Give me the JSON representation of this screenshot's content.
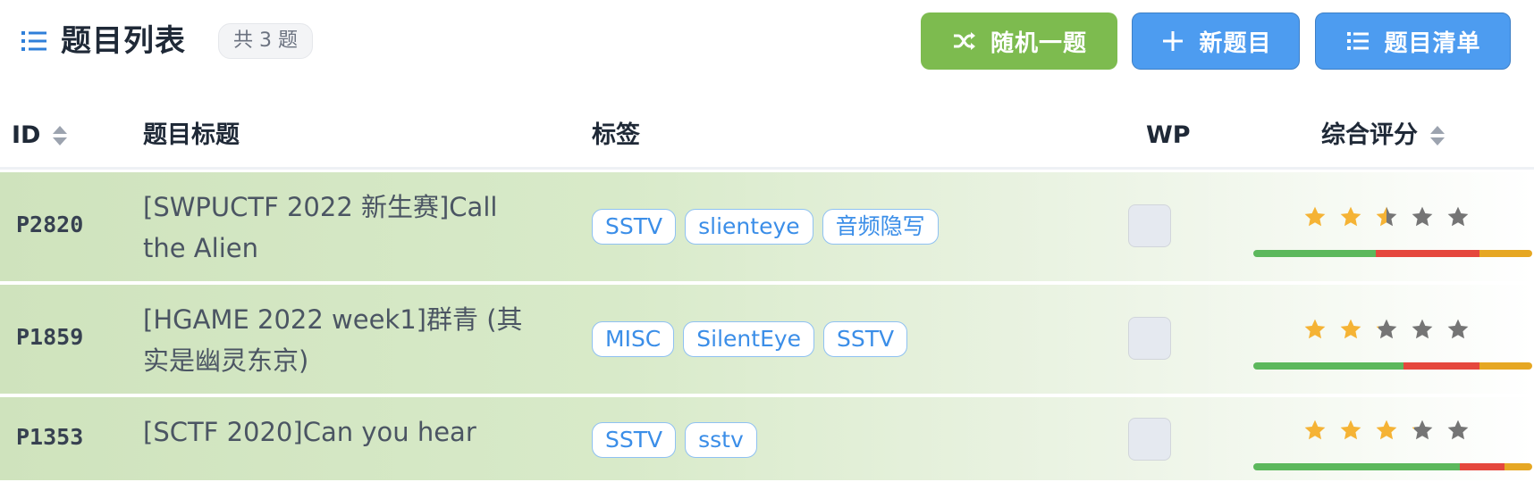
{
  "header": {
    "title": "题目列表",
    "count_badge": "共 3 题",
    "buttons": {
      "random": "随机一题",
      "new": "新题目",
      "list": "题目清单"
    }
  },
  "table": {
    "columns": {
      "id": "ID",
      "title": "题目标题",
      "tags": "标签",
      "wp": "WP",
      "rating": "综合评分"
    },
    "rows": [
      {
        "id": "P2820",
        "title_line1": "[SWPUCTF 2022 新生赛]Call",
        "title_line2": "the Alien",
        "tags": [
          "SSTV",
          "slienteye",
          "音频隐写"
        ],
        "stars_filled": 2.5,
        "rating_split": [
          0.44,
          0.37,
          0.19
        ]
      },
      {
        "id": "P1859",
        "title_line1": "[HGAME 2022 week1]群青 (其",
        "title_line2": "实是幽灵东京)",
        "tags": [
          "MISC",
          "SilentEye",
          "SSTV"
        ],
        "stars_filled": 2.1,
        "rating_split": [
          0.54,
          0.27,
          0.19
        ]
      },
      {
        "id": "P1353",
        "title_line1": "[SCTF 2020]Can you hear",
        "title_line2": "",
        "tags": [
          "SSTV",
          "sstv"
        ],
        "stars_filled": 3.1,
        "rating_split": [
          0.74,
          0.16,
          0.1
        ]
      }
    ]
  },
  "colors": {
    "accent_blue": "#4d9cf0",
    "random_green": "#7dbb4f",
    "star_filled": "#f5b335",
    "star_empty": "#757575"
  }
}
